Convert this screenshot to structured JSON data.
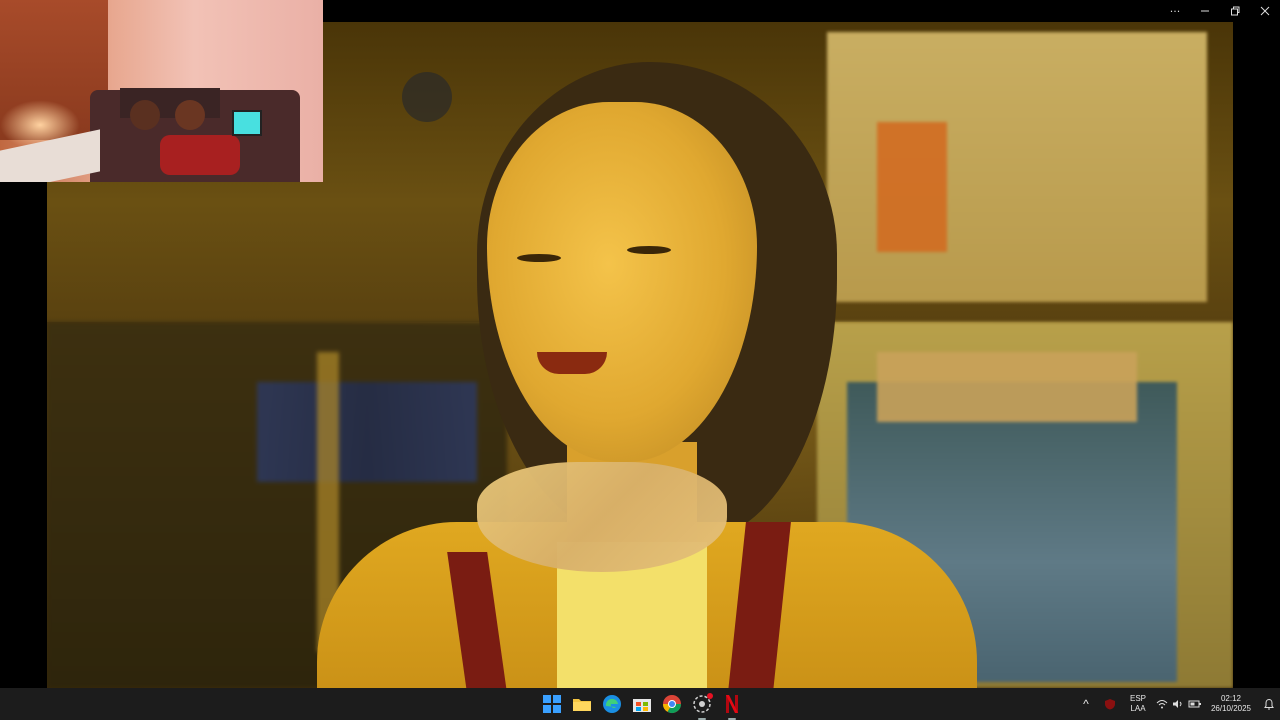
{
  "window": {
    "controls": {
      "more_label": "···",
      "minimize_icon": "minimize-icon",
      "restore_icon": "restore-icon",
      "close_icon": "close-icon"
    }
  },
  "video": {
    "description_icon": "video-frame"
  },
  "webcam": {
    "icon": "webcam-overlay"
  },
  "taskbar": {
    "apps": [
      {
        "name": "start-button",
        "icon": "windows-logo-icon"
      },
      {
        "name": "file-explorer",
        "icon": "folder-icon"
      },
      {
        "name": "edge",
        "icon": "edge-icon"
      },
      {
        "name": "microsoft-store",
        "icon": "store-icon"
      },
      {
        "name": "chrome",
        "icon": "chrome-icon"
      },
      {
        "name": "app-with-notification",
        "icon": "circle-app-icon"
      },
      {
        "name": "netflix",
        "icon": "netflix-icon"
      }
    ],
    "tray": {
      "chevron": "^",
      "lang_top": "ESP",
      "lang_bottom": "LAA",
      "time": "02:12",
      "date": "26/10/2025"
    }
  },
  "colors": {
    "taskbar_bg": "#1c1c1c",
    "netflix_red": "#e50914",
    "windows_blue": "#3aa0ff"
  }
}
